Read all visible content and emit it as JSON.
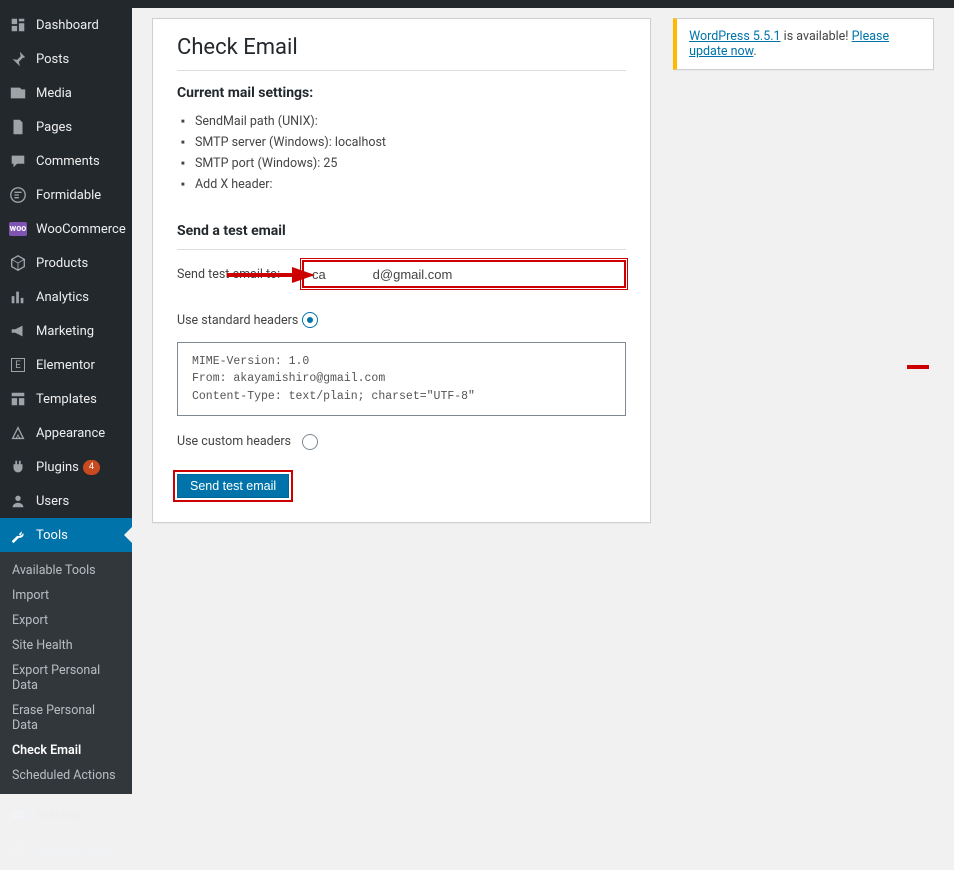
{
  "sidebar": {
    "items": [
      {
        "label": "Dashboard",
        "icon": "dashboard-icon"
      },
      {
        "label": "Posts",
        "icon": "pin-icon"
      },
      {
        "label": "Media",
        "icon": "media-icon"
      },
      {
        "label": "Pages",
        "icon": "pages-icon"
      },
      {
        "label": "Comments",
        "icon": "comments-icon"
      },
      {
        "label": "Formidable",
        "icon": "formidable-icon"
      },
      {
        "label": "WooCommerce",
        "icon": "woocommerce-icon"
      },
      {
        "label": "Products",
        "icon": "products-icon"
      },
      {
        "label": "Analytics",
        "icon": "analytics-icon"
      },
      {
        "label": "Marketing",
        "icon": "marketing-icon"
      },
      {
        "label": "Elementor",
        "icon": "elementor-icon"
      },
      {
        "label": "Templates",
        "icon": "templates-icon"
      },
      {
        "label": "Appearance",
        "icon": "appearance-icon"
      },
      {
        "label": "Plugins",
        "icon": "plugins-icon",
        "badge": "4"
      },
      {
        "label": "Users",
        "icon": "users-icon"
      },
      {
        "label": "Tools",
        "icon": "tools-icon",
        "current": true
      },
      {
        "label": "Settings",
        "icon": "settings-icon"
      }
    ],
    "submenu": [
      {
        "label": "Available Tools"
      },
      {
        "label": "Import"
      },
      {
        "label": "Export"
      },
      {
        "label": "Site Health"
      },
      {
        "label": "Export Personal Data"
      },
      {
        "label": "Erase Personal Data"
      },
      {
        "label": "Check Email",
        "current": true
      },
      {
        "label": "Scheduled Actions"
      }
    ],
    "collapse_label": "Collapse menu"
  },
  "main": {
    "title": "Check Email",
    "settings_heading": "Current mail settings:",
    "settings": [
      {
        "label": "SendMail path (UNIX):",
        "value": ""
      },
      {
        "label": "SMTP server (Windows): ",
        "value": "localhost"
      },
      {
        "label": "SMTP port (Windows): ",
        "value": "25"
      },
      {
        "label": "Add X header:",
        "value": ""
      }
    ],
    "test_heading": "Send a test email",
    "send_to_label": "Send test email to:",
    "send_to_value": "ca             d@gmail.com",
    "standard_label": "Use standard headers",
    "headers_text": "MIME-Version: 1.0\nFrom: akayamishiro@gmail.com\nContent-Type: text/plain; charset=\"UTF-8\"",
    "custom_label": "Use custom headers",
    "submit_label": "Send test email"
  },
  "notice": {
    "link1": "WordPress 5.5.1",
    "mid": " is available! ",
    "link2": "Please update now",
    "tail": "."
  }
}
